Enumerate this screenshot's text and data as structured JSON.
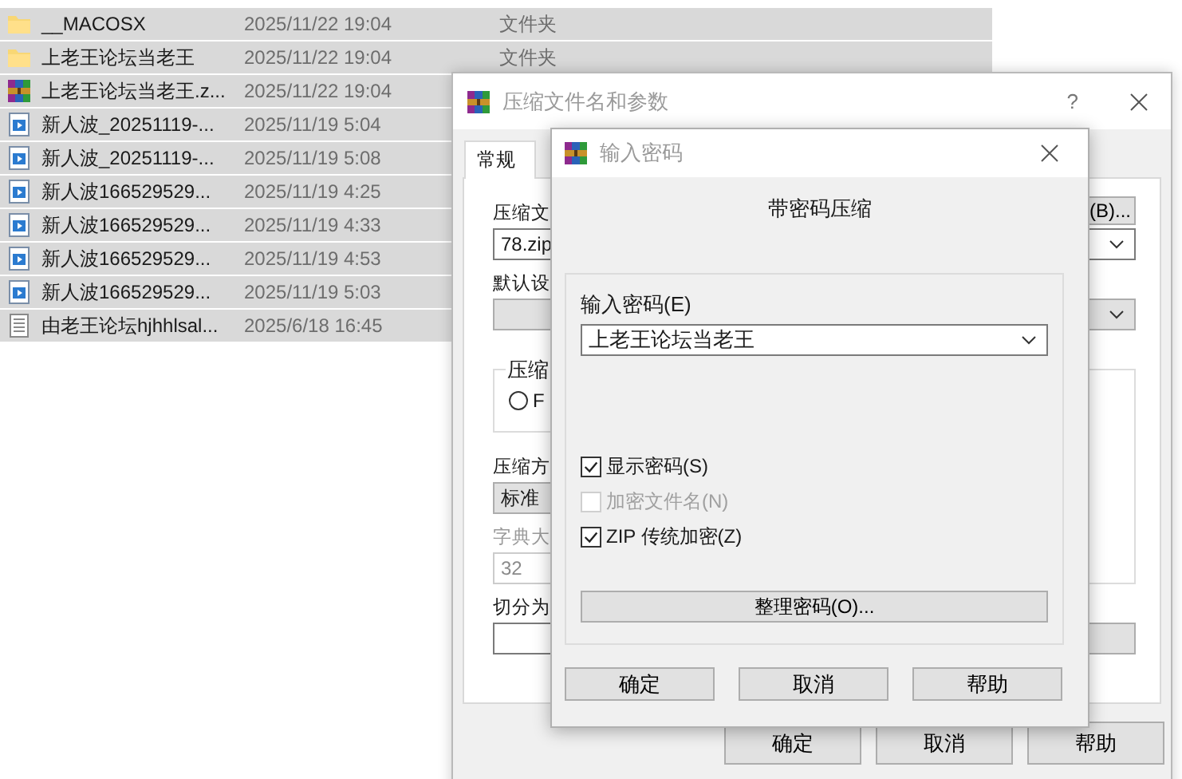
{
  "files": [
    {
      "kind": "folder",
      "name": "__MACOSX",
      "date": "2025/11/22 19:04",
      "type": "文件夹",
      "selected": true
    },
    {
      "kind": "folder",
      "name": "上老王论坛当老王",
      "date": "2025/11/22 19:04",
      "type": "文件夹",
      "selected": true
    },
    {
      "kind": "archive",
      "name": "上老王论坛当老王.z...",
      "date": "2025/11/22 19:04",
      "selected": true
    },
    {
      "kind": "video",
      "name": "新人波_20251119-...",
      "date": "2025/11/19 5:04",
      "selected": true
    },
    {
      "kind": "video",
      "name": "新人波_20251119-...",
      "date": "2025/11/19 5:08",
      "selected": true
    },
    {
      "kind": "video",
      "name": "新人波166529529...",
      "date": "2025/11/19 4:25",
      "selected": true
    },
    {
      "kind": "video",
      "name": "新人波166529529...",
      "date": "2025/11/19 4:33",
      "selected": true
    },
    {
      "kind": "video",
      "name": "新人波166529529...",
      "date": "2025/11/19 4:53",
      "selected": true
    },
    {
      "kind": "video",
      "name": "新人波166529529...",
      "date": "2025/11/19 5:03",
      "selected": true
    },
    {
      "kind": "text",
      "name": "由老王论坛hjhhlsal...",
      "date": "2025/6/18 16:45",
      "selected": true
    }
  ],
  "archive_dialog": {
    "title": "压缩文件名和参数",
    "help_button": "?",
    "tabs": [
      {
        "label": "常规",
        "selected": true
      }
    ],
    "archive_name_label": "压缩文",
    "browse_button": "(B)...",
    "archive_name": "78.zip",
    "profile_label": "默认设",
    "group_label": "压缩",
    "radio": {
      "label": "F",
      "selected": false
    },
    "method_label": "压缩方",
    "method": "标准",
    "dictionary_label": "字典大",
    "dictionary": "32",
    "split_label": "切分为",
    "buttons": [
      "确定",
      "取消",
      "帮助"
    ]
  },
  "password_dialog": {
    "title": "输入密码",
    "heading": "带密码压缩",
    "password_label": "输入密码(E)",
    "password": "上老王论坛当老王",
    "options": [
      {
        "label": "显示密码(S)",
        "checked": true,
        "disabled": false
      },
      {
        "label": "加密文件名(N)",
        "checked": false,
        "disabled": true
      },
      {
        "label": "ZIP 传统加密(Z)",
        "checked": true,
        "disabled": false
      }
    ],
    "organize_button": "整理密码(O)...",
    "buttons": [
      "确定",
      "取消",
      "帮助"
    ]
  }
}
